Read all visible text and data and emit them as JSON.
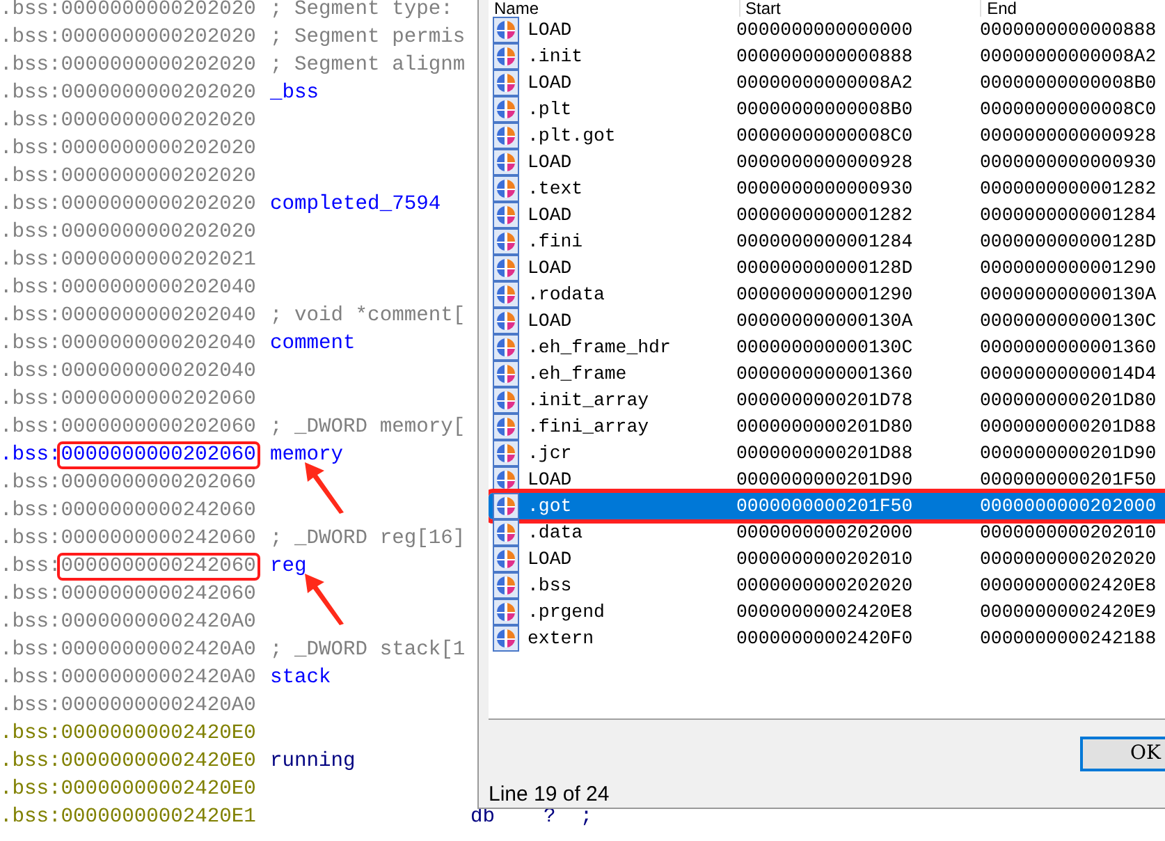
{
  "listing": [
    {
      "prefix": ".bss:",
      "address": "0000000000202020",
      "text": "; Segment type:",
      "kind": "comment",
      "color": "#808080",
      "boxed": false,
      "arrow": false
    },
    {
      "prefix": ".bss:",
      "address": "0000000000202020",
      "text": "; Segment permis",
      "kind": "comment",
      "color": "#808080",
      "boxed": false,
      "arrow": false
    },
    {
      "prefix": ".bss:",
      "address": "0000000000202020",
      "text": "; Segment alignm",
      "kind": "comment",
      "color": "#808080",
      "boxed": false,
      "arrow": false
    },
    {
      "prefix": ".bss:",
      "address": "0000000000202020",
      "text": "_bss",
      "kind": "label",
      "color": "#808080",
      "boxed": false,
      "arrow": false
    },
    {
      "prefix": ".bss:",
      "address": "0000000000202020",
      "color": "#808080",
      "boxed": false,
      "arrow": false
    },
    {
      "prefix": ".bss:",
      "address": "0000000000202020",
      "color": "#808080",
      "boxed": false,
      "arrow": false
    },
    {
      "prefix": ".bss:",
      "address": "0000000000202020",
      "color": "#808080",
      "boxed": false,
      "arrow": false
    },
    {
      "prefix": ".bss:",
      "address": "0000000000202020",
      "text": "completed_7594",
      "kind": "label",
      "color": "#808080",
      "boxed": false,
      "arrow": false
    },
    {
      "prefix": ".bss:",
      "address": "0000000000202020",
      "color": "#808080",
      "boxed": false,
      "arrow": false
    },
    {
      "prefix": ".bss:",
      "address": "0000000000202021",
      "color": "#808080",
      "boxed": false,
      "arrow": false
    },
    {
      "prefix": ".bss:",
      "address": "0000000000202040",
      "color": "#808080",
      "boxed": false,
      "arrow": false
    },
    {
      "prefix": ".bss:",
      "address": "0000000000202040",
      "text": "; void *comment[",
      "kind": "comment",
      "color": "#808080",
      "boxed": false,
      "arrow": false
    },
    {
      "prefix": ".bss:",
      "address": "0000000000202040",
      "text": "comment",
      "kind": "label",
      "color": "#808080",
      "boxed": false,
      "arrow": false
    },
    {
      "prefix": ".bss:",
      "address": "0000000000202040",
      "color": "#808080",
      "boxed": false,
      "arrow": false
    },
    {
      "prefix": ".bss:",
      "address": "0000000000202060",
      "color": "#808080",
      "boxed": false,
      "arrow": false
    },
    {
      "prefix": ".bss:",
      "address": "0000000000202060",
      "text": "; _DWORD memory[",
      "kind": "comment",
      "color": "#808080",
      "boxed": false,
      "arrow": false
    },
    {
      "prefix": ".bss:",
      "address": "0000000000202060",
      "text": "memory",
      "kind": "label",
      "color": "#0000ff",
      "boxed": true,
      "arrow": true
    },
    {
      "prefix": ".bss:",
      "address": "0000000000202060",
      "color": "#808080",
      "boxed": false,
      "arrow": false
    },
    {
      "prefix": ".bss:",
      "address": "0000000000242060",
      "color": "#808080",
      "boxed": false,
      "arrow": false
    },
    {
      "prefix": ".bss:",
      "address": "0000000000242060",
      "text": "; _DWORD reg[16]",
      "kind": "comment",
      "color": "#808080",
      "boxed": false,
      "arrow": false
    },
    {
      "prefix": ".bss:",
      "address": "0000000000242060",
      "text": "reg",
      "kind": "label",
      "color": "#808080",
      "boxed": true,
      "arrow": true
    },
    {
      "prefix": ".bss:",
      "address": "0000000000242060",
      "color": "#808080",
      "boxed": false,
      "arrow": false
    },
    {
      "prefix": ".bss:",
      "address": "00000000002420A0",
      "color": "#808080",
      "boxed": false,
      "arrow": false
    },
    {
      "prefix": ".bss:",
      "address": "00000000002420A0",
      "text": "; _DWORD stack[1",
      "kind": "comment",
      "color": "#808080",
      "boxed": false,
      "arrow": false
    },
    {
      "prefix": ".bss:",
      "address": "00000000002420A0",
      "text": "stack",
      "kind": "label",
      "color": "#808080",
      "boxed": false,
      "arrow": false
    },
    {
      "prefix": ".bss:",
      "address": "00000000002420A0",
      "color": "#808080",
      "boxed": false,
      "arrow": false
    },
    {
      "prefix": ".bss:",
      "address": "00000000002420E0",
      "color": "#808000",
      "boxed": false,
      "arrow": false
    },
    {
      "prefix": ".bss:",
      "address": "00000000002420E0",
      "text": "running",
      "kind": "label",
      "color": "#808000",
      "boxed": false,
      "arrow": false
    },
    {
      "prefix": ".bss:",
      "address": "00000000002420E0",
      "color": "#808000",
      "boxed": false,
      "arrow": false
    },
    {
      "prefix": ".bss:",
      "address": "00000000002420E1",
      "color": "#808000",
      "boxed": false,
      "arrow": false,
      "instruction": "db    ?  ;"
    }
  ],
  "segments_dialog": {
    "columns": [
      "Name",
      "Start",
      "End"
    ],
    "rows": [
      {
        "name": "LOAD",
        "start": "0000000000000000",
        "end": "0000000000000888",
        "selected": false
      },
      {
        "name": ".init",
        "start": "0000000000000888",
        "end": "00000000000008A2",
        "selected": false
      },
      {
        "name": "LOAD",
        "start": "00000000000008A2",
        "end": "00000000000008B0",
        "selected": false
      },
      {
        "name": ".plt",
        "start": "00000000000008B0",
        "end": "00000000000008C0",
        "selected": false
      },
      {
        "name": ".plt.got",
        "start": "00000000000008C0",
        "end": "0000000000000928",
        "selected": false
      },
      {
        "name": "LOAD",
        "start": "0000000000000928",
        "end": "0000000000000930",
        "selected": false
      },
      {
        "name": ".text",
        "start": "0000000000000930",
        "end": "0000000000001282",
        "selected": false
      },
      {
        "name": "LOAD",
        "start": "0000000000001282",
        "end": "0000000000001284",
        "selected": false
      },
      {
        "name": ".fini",
        "start": "0000000000001284",
        "end": "000000000000128D",
        "selected": false
      },
      {
        "name": "LOAD",
        "start": "000000000000128D",
        "end": "0000000000001290",
        "selected": false
      },
      {
        "name": ".rodata",
        "start": "0000000000001290",
        "end": "000000000000130A",
        "selected": false
      },
      {
        "name": "LOAD",
        "start": "000000000000130A",
        "end": "000000000000130C",
        "selected": false
      },
      {
        "name": ".eh_frame_hdr",
        "start": "000000000000130C",
        "end": "0000000000001360",
        "selected": false
      },
      {
        "name": ".eh_frame",
        "start": "0000000000001360",
        "end": "00000000000014D4",
        "selected": false
      },
      {
        "name": ".init_array",
        "start": "0000000000201D78",
        "end": "0000000000201D80",
        "selected": false
      },
      {
        "name": ".fini_array",
        "start": "0000000000201D80",
        "end": "0000000000201D88",
        "selected": false
      },
      {
        "name": ".jcr",
        "start": "0000000000201D88",
        "end": "0000000000201D90",
        "selected": false
      },
      {
        "name": "LOAD",
        "start": "0000000000201D90",
        "end": "0000000000201F50",
        "selected": false
      },
      {
        "name": ".got",
        "start": "0000000000201F50",
        "end": "0000000000202000",
        "selected": true,
        "boxed": true
      },
      {
        "name": ".data",
        "start": "0000000000202000",
        "end": "0000000000202010",
        "selected": false
      },
      {
        "name": "LOAD",
        "start": "0000000000202010",
        "end": "0000000000202020",
        "selected": false
      },
      {
        "name": ".bss",
        "start": "0000000000202020",
        "end": "00000000002420E8",
        "selected": false
      },
      {
        "name": ".prgend",
        "start": "00000000002420E8",
        "end": "00000000002420E9",
        "selected": false
      },
      {
        "name": "extern",
        "start": "00000000002420F0",
        "end": "0000000000242188",
        "selected": false
      }
    ],
    "status": "Line 19 of 24",
    "ok_button": "OK"
  }
}
